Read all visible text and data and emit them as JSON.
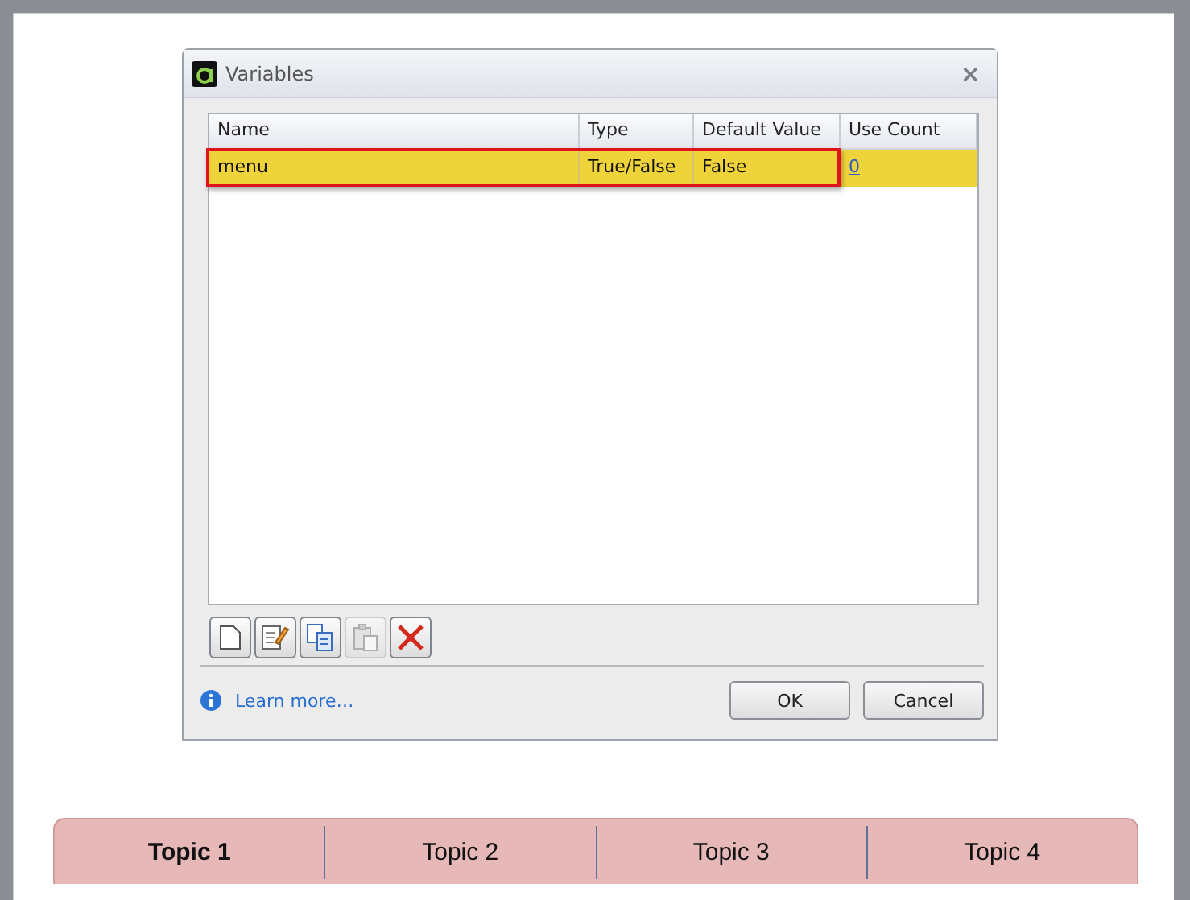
{
  "dialog": {
    "title": "Variables",
    "close": "×"
  },
  "table": {
    "columns": [
      "Name",
      "Type",
      "Default Value",
      "Use Count"
    ],
    "rows": [
      {
        "name": "menu",
        "type": "True/False",
        "default_value": "False",
        "use_count": "0",
        "selected": true
      }
    ]
  },
  "toolbar": [
    {
      "kind": "new",
      "disabled": false
    },
    {
      "kind": "edit",
      "disabled": false
    },
    {
      "kind": "copy",
      "disabled": false
    },
    {
      "kind": "paste",
      "disabled": true
    },
    {
      "kind": "delete",
      "disabled": false
    }
  ],
  "learn_more": "Learn more…",
  "buttons": [
    "OK",
    "Cancel"
  ],
  "tabs": [
    {
      "label": "Topic 1",
      "selected": true
    },
    {
      "label": "Topic 2",
      "selected": false
    },
    {
      "label": "Topic 3",
      "selected": false
    },
    {
      "label": "Topic 4",
      "selected": false
    }
  ]
}
